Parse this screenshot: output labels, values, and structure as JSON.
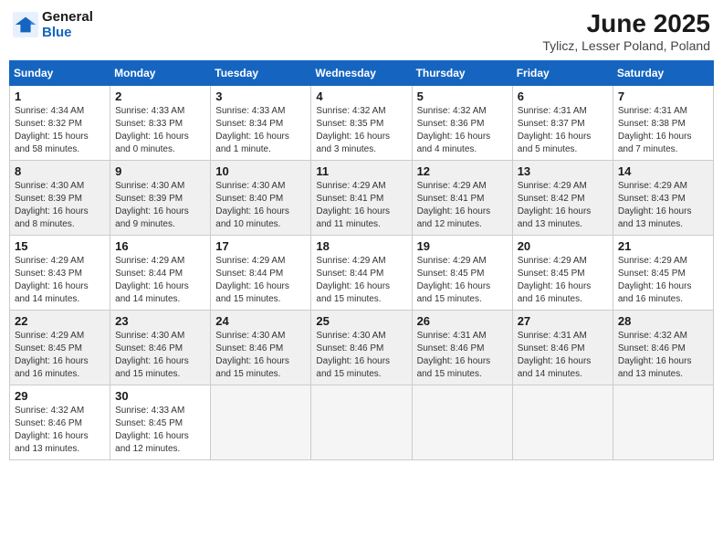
{
  "logo": {
    "line1": "General",
    "line2": "Blue"
  },
  "title": {
    "month_year": "June 2025",
    "location": "Tylicz, Lesser Poland, Poland"
  },
  "weekdays": [
    "Sunday",
    "Monday",
    "Tuesday",
    "Wednesday",
    "Thursday",
    "Friday",
    "Saturday"
  ],
  "weeks": [
    [
      {
        "day": "1",
        "lines": [
          "Sunrise: 4:34 AM",
          "Sunset: 8:32 PM",
          "Daylight: 15 hours",
          "and 58 minutes."
        ]
      },
      {
        "day": "2",
        "lines": [
          "Sunrise: 4:33 AM",
          "Sunset: 8:33 PM",
          "Daylight: 16 hours",
          "and 0 minutes."
        ]
      },
      {
        "day": "3",
        "lines": [
          "Sunrise: 4:33 AM",
          "Sunset: 8:34 PM",
          "Daylight: 16 hours",
          "and 1 minute."
        ]
      },
      {
        "day": "4",
        "lines": [
          "Sunrise: 4:32 AM",
          "Sunset: 8:35 PM",
          "Daylight: 16 hours",
          "and 3 minutes."
        ]
      },
      {
        "day": "5",
        "lines": [
          "Sunrise: 4:32 AM",
          "Sunset: 8:36 PM",
          "Daylight: 16 hours",
          "and 4 minutes."
        ]
      },
      {
        "day": "6",
        "lines": [
          "Sunrise: 4:31 AM",
          "Sunset: 8:37 PM",
          "Daylight: 16 hours",
          "and 5 minutes."
        ]
      },
      {
        "day": "7",
        "lines": [
          "Sunrise: 4:31 AM",
          "Sunset: 8:38 PM",
          "Daylight: 16 hours",
          "and 7 minutes."
        ]
      }
    ],
    [
      {
        "day": "8",
        "lines": [
          "Sunrise: 4:30 AM",
          "Sunset: 8:39 PM",
          "Daylight: 16 hours",
          "and 8 minutes."
        ]
      },
      {
        "day": "9",
        "lines": [
          "Sunrise: 4:30 AM",
          "Sunset: 8:39 PM",
          "Daylight: 16 hours",
          "and 9 minutes."
        ]
      },
      {
        "day": "10",
        "lines": [
          "Sunrise: 4:30 AM",
          "Sunset: 8:40 PM",
          "Daylight: 16 hours",
          "and 10 minutes."
        ]
      },
      {
        "day": "11",
        "lines": [
          "Sunrise: 4:29 AM",
          "Sunset: 8:41 PM",
          "Daylight: 16 hours",
          "and 11 minutes."
        ]
      },
      {
        "day": "12",
        "lines": [
          "Sunrise: 4:29 AM",
          "Sunset: 8:41 PM",
          "Daylight: 16 hours",
          "and 12 minutes."
        ]
      },
      {
        "day": "13",
        "lines": [
          "Sunrise: 4:29 AM",
          "Sunset: 8:42 PM",
          "Daylight: 16 hours",
          "and 13 minutes."
        ]
      },
      {
        "day": "14",
        "lines": [
          "Sunrise: 4:29 AM",
          "Sunset: 8:43 PM",
          "Daylight: 16 hours",
          "and 13 minutes."
        ]
      }
    ],
    [
      {
        "day": "15",
        "lines": [
          "Sunrise: 4:29 AM",
          "Sunset: 8:43 PM",
          "Daylight: 16 hours",
          "and 14 minutes."
        ]
      },
      {
        "day": "16",
        "lines": [
          "Sunrise: 4:29 AM",
          "Sunset: 8:44 PM",
          "Daylight: 16 hours",
          "and 14 minutes."
        ]
      },
      {
        "day": "17",
        "lines": [
          "Sunrise: 4:29 AM",
          "Sunset: 8:44 PM",
          "Daylight: 16 hours",
          "and 15 minutes."
        ]
      },
      {
        "day": "18",
        "lines": [
          "Sunrise: 4:29 AM",
          "Sunset: 8:44 PM",
          "Daylight: 16 hours",
          "and 15 minutes."
        ]
      },
      {
        "day": "19",
        "lines": [
          "Sunrise: 4:29 AM",
          "Sunset: 8:45 PM",
          "Daylight: 16 hours",
          "and 15 minutes."
        ]
      },
      {
        "day": "20",
        "lines": [
          "Sunrise: 4:29 AM",
          "Sunset: 8:45 PM",
          "Daylight: 16 hours",
          "and 16 minutes."
        ]
      },
      {
        "day": "21",
        "lines": [
          "Sunrise: 4:29 AM",
          "Sunset: 8:45 PM",
          "Daylight: 16 hours",
          "and 16 minutes."
        ]
      }
    ],
    [
      {
        "day": "22",
        "lines": [
          "Sunrise: 4:29 AM",
          "Sunset: 8:45 PM",
          "Daylight: 16 hours",
          "and 16 minutes."
        ]
      },
      {
        "day": "23",
        "lines": [
          "Sunrise: 4:30 AM",
          "Sunset: 8:46 PM",
          "Daylight: 16 hours",
          "and 15 minutes."
        ]
      },
      {
        "day": "24",
        "lines": [
          "Sunrise: 4:30 AM",
          "Sunset: 8:46 PM",
          "Daylight: 16 hours",
          "and 15 minutes."
        ]
      },
      {
        "day": "25",
        "lines": [
          "Sunrise: 4:30 AM",
          "Sunset: 8:46 PM",
          "Daylight: 16 hours",
          "and 15 minutes."
        ]
      },
      {
        "day": "26",
        "lines": [
          "Sunrise: 4:31 AM",
          "Sunset: 8:46 PM",
          "Daylight: 16 hours",
          "and 15 minutes."
        ]
      },
      {
        "day": "27",
        "lines": [
          "Sunrise: 4:31 AM",
          "Sunset: 8:46 PM",
          "Daylight: 16 hours",
          "and 14 minutes."
        ]
      },
      {
        "day": "28",
        "lines": [
          "Sunrise: 4:32 AM",
          "Sunset: 8:46 PM",
          "Daylight: 16 hours",
          "and 13 minutes."
        ]
      }
    ],
    [
      {
        "day": "29",
        "lines": [
          "Sunrise: 4:32 AM",
          "Sunset: 8:46 PM",
          "Daylight: 16 hours",
          "and 13 minutes."
        ]
      },
      {
        "day": "30",
        "lines": [
          "Sunrise: 4:33 AM",
          "Sunset: 8:45 PM",
          "Daylight: 16 hours",
          "and 12 minutes."
        ]
      },
      {
        "day": "",
        "lines": []
      },
      {
        "day": "",
        "lines": []
      },
      {
        "day": "",
        "lines": []
      },
      {
        "day": "",
        "lines": []
      },
      {
        "day": "",
        "lines": []
      }
    ]
  ]
}
